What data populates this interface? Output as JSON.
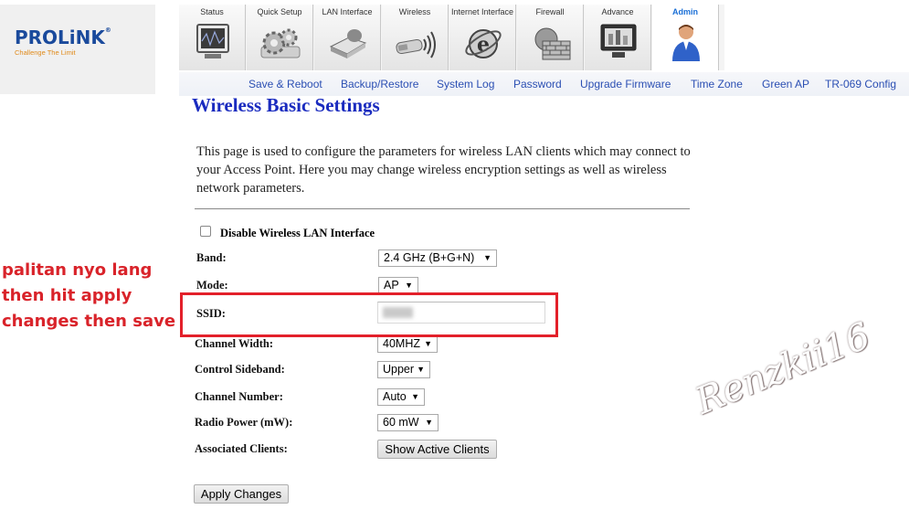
{
  "brand": {
    "name": "PROLiNK",
    "reg_mark": "®",
    "tagline": "Challenge The Limit"
  },
  "nav_tabs": [
    {
      "label": "Status",
      "icon": "monitor-icon"
    },
    {
      "label": "Quick Setup",
      "icon": "gears-icon"
    },
    {
      "label": "LAN Interface",
      "icon": "router-icon"
    },
    {
      "label": "Wireless",
      "icon": "wireless-adapter-icon"
    },
    {
      "label": "Internet Interface",
      "icon": "internet-explorer-icon"
    },
    {
      "label": "Firewall",
      "icon": "firewall-icon"
    },
    {
      "label": "Advance",
      "icon": "advance-monitor-icon"
    },
    {
      "label": "Admin",
      "icon": "admin-user-icon",
      "active": true
    }
  ],
  "sub_nav": [
    "Save & Reboot",
    "Backup/Restore",
    "System Log",
    "Password",
    "Upgrade Firmware",
    "Time Zone",
    "Green AP",
    "TR-069 Config"
  ],
  "page": {
    "title": "Wireless Basic Settings",
    "description": "This page is used to configure the parameters for wireless LAN clients which may connect to your Access Point. Here you may change wireless encryption settings as well as wireless network parameters."
  },
  "form": {
    "disable_wlan": {
      "label": "Disable Wireless LAN Interface",
      "checked": false
    },
    "band": {
      "label": "Band:",
      "value": "2.4 GHz (B+G+N)"
    },
    "mode": {
      "label": "Mode:",
      "value": "AP"
    },
    "ssid": {
      "label": "SSID:"
    },
    "channel_width": {
      "label": "Channel Width:",
      "value": "40MHZ"
    },
    "control_sideband": {
      "label": "Control Sideband:",
      "value": "Upper"
    },
    "channel_number": {
      "label": "Channel Number:",
      "value": "Auto"
    },
    "radio_power": {
      "label": "Radio Power (mW):",
      "value": "60 mW"
    },
    "associated_clients": {
      "label": "Associated Clients:",
      "button": "Show Active Clients"
    },
    "apply_button": "Apply Changes"
  },
  "annotation": {
    "lines": [
      "palitan nyo lang",
      "then hit apply",
      "changes then save"
    ],
    "highlight_color": "#e3202a"
  },
  "watermark": "Renzkii16",
  "colors": {
    "title": "#1a2bbf",
    "link": "#2b4fb3",
    "annotation": "#d9232a",
    "brand": "#1a4a9c",
    "tagline": "#e08a1a"
  }
}
